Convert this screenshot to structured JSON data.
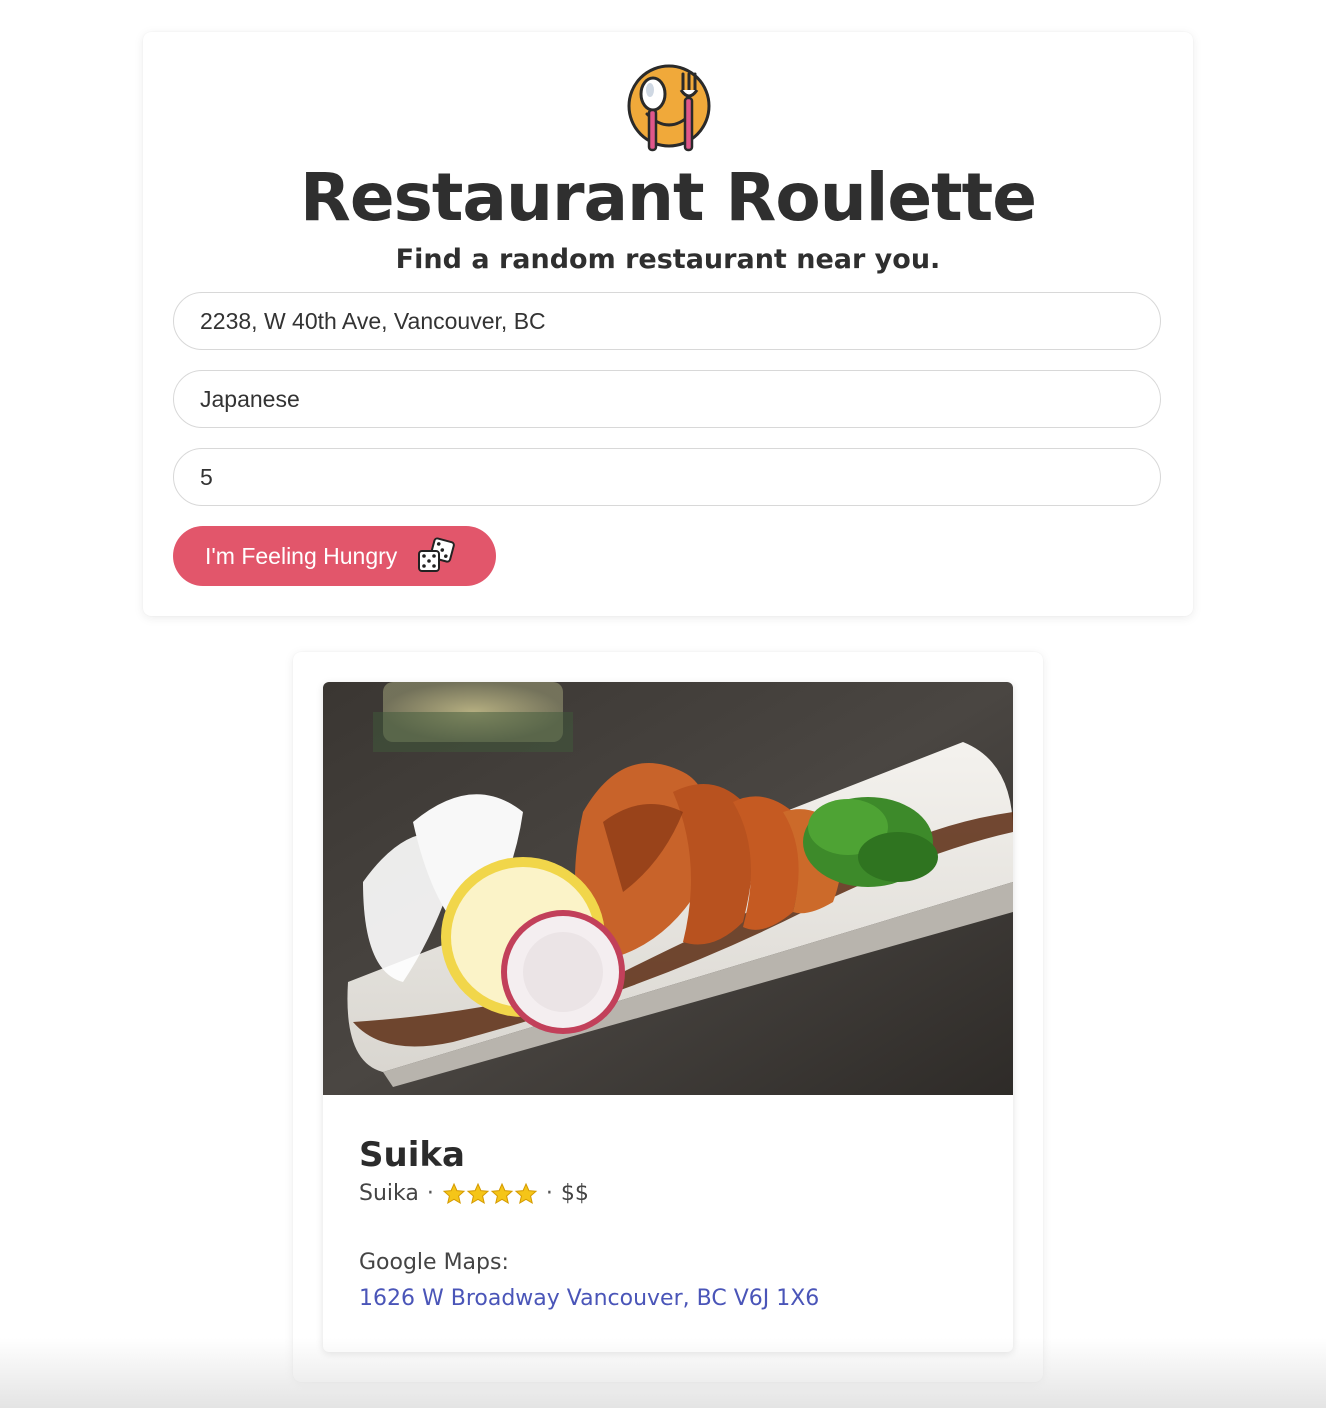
{
  "header": {
    "logo_icon": "smiling-plate-with-spoon-and-fork-icon",
    "title": "Restaurant Roulette",
    "subtitle": "Find a random restaurant near you."
  },
  "search": {
    "location_value": "2238, W 40th Ave, Vancouver, BC",
    "cuisine_value": "Japanese",
    "radius_value": "5",
    "submit_label": "I'm Feeling Hungry",
    "submit_icon": "dice-icon"
  },
  "result": {
    "name": "Suika",
    "subname": "Suika",
    "rating_stars": 4,
    "rating_icon": "star-icon",
    "price": "$$",
    "separator": "·",
    "maps_label": "Google Maps:",
    "address": "1626 W Broadway Vancouver, BC V6J 1X6"
  },
  "colors": {
    "button_bg": "#e2566b",
    "link": "#4a55b8",
    "title_text": "#2f2f2f",
    "star": "#f5c518"
  }
}
